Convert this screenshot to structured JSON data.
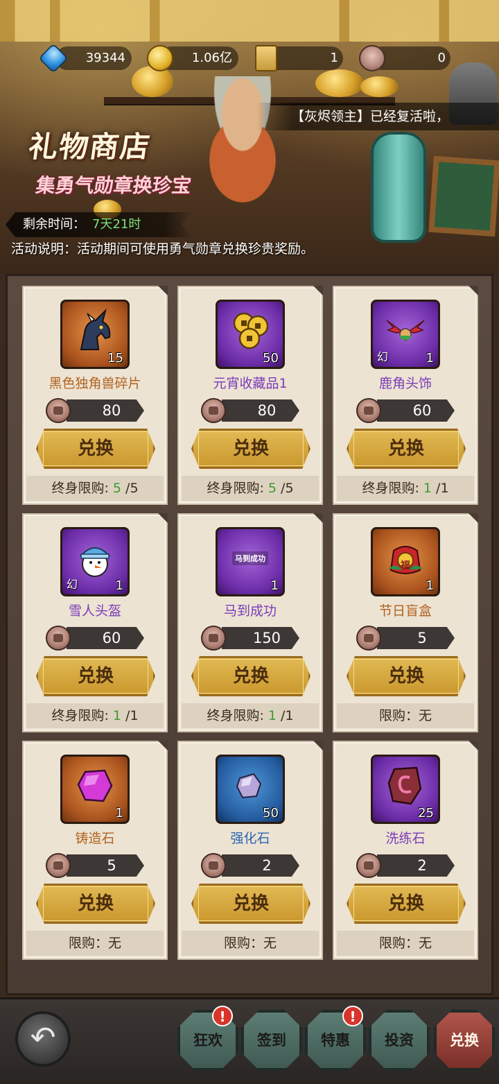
{
  "resources": {
    "diamond": "39344",
    "gold": "1.06亿",
    "scroll": "1",
    "medal": "0"
  },
  "notice": "【灰烬领主】已经复活啦，",
  "header": {
    "title": "礼物商店",
    "subtitle": "集勇气勋章换珍宝",
    "timer_label": "剩余时间：",
    "timer_value": "7天21时",
    "activity_desc": "活动说明：活动期间可使用勇气勋章兑换珍贵奖励。"
  },
  "exchange_label": "兑换",
  "items": [
    {
      "name": "黑色独角兽碎片",
      "count": "15",
      "tag": "",
      "price": "80",
      "limit_label": "终身限购:",
      "limit_cur": "5",
      "limit_max": "/5",
      "rarity": "orange",
      "icon": "unicorn-icon"
    },
    {
      "name": "元宵收藏品1",
      "count": "50",
      "tag": "",
      "price": "80",
      "limit_label": "终身限购:",
      "limit_cur": "5",
      "limit_max": "/5",
      "rarity": "purple",
      "icon": "coins-icon"
    },
    {
      "name": "鹿角头饰",
      "count": "1",
      "tag": "幻",
      "price": "60",
      "limit_label": "终身限购:",
      "limit_cur": "1",
      "limit_max": "/1",
      "rarity": "purple",
      "icon": "antler-headwear-icon"
    },
    {
      "name": "雪人头盔",
      "count": "1",
      "tag": "幻",
      "price": "60",
      "limit_label": "终身限购:",
      "limit_cur": "1",
      "limit_max": "/1",
      "rarity": "purple",
      "icon": "snowman-helmet-icon"
    },
    {
      "name": "马到成功",
      "count": "1",
      "tag": "",
      "price": "150",
      "limit_label": "终身限购:",
      "limit_cur": "1",
      "limit_max": "/1",
      "rarity": "purple",
      "icon": "banner-icon",
      "art_text": "马到成功"
    },
    {
      "name": "节日盲盒",
      "count": "1",
      "tag": "",
      "price": "5",
      "limit_label": "限购：无",
      "limit_cur": "",
      "limit_max": "",
      "rarity": "orange",
      "icon": "blind-box-icon",
      "art_text": "福"
    },
    {
      "name": "铸造石",
      "count": "1",
      "tag": "",
      "price": "5",
      "limit_label": "限购：无",
      "limit_cur": "",
      "limit_max": "",
      "rarity": "orange",
      "icon": "forge-stone-icon"
    },
    {
      "name": "强化石",
      "count": "50",
      "tag": "",
      "price": "2",
      "limit_label": "限购：无",
      "limit_cur": "",
      "limit_max": "",
      "rarity": "blue",
      "icon": "enhance-stone-icon"
    },
    {
      "name": "洗练石",
      "count": "25",
      "tag": "",
      "price": "2",
      "limit_label": "限购：无",
      "limit_cur": "",
      "limit_max": "",
      "rarity": "purple",
      "icon": "refine-stone-icon"
    }
  ],
  "nav": {
    "carnival": "狂欢",
    "checkin": "签到",
    "special": "特惠",
    "invest": "投资",
    "exchange": "兑换",
    "badge": "!"
  }
}
